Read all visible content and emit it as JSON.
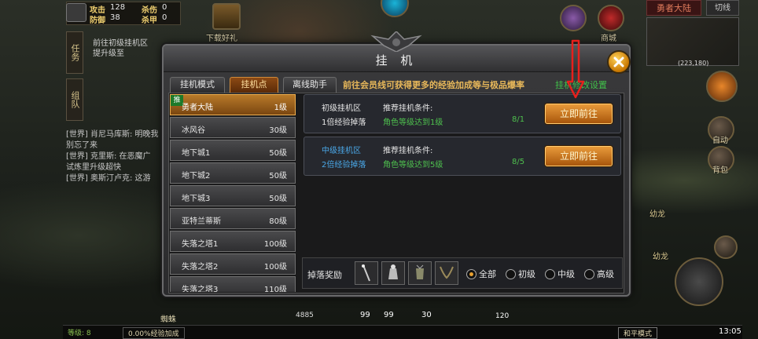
{
  "hud": {
    "attack_label": "攻击",
    "attack_value": "128",
    "pk_label": "杀伤",
    "pk_value": "0",
    "defense_label": "防御",
    "defense_value": "38",
    "armor_label": "杀甲",
    "armor_value": "0",
    "task_tab": "任务",
    "team_tab": "组队",
    "quest_line1": "前往初级挂机区",
    "quest_line2": "提升级至",
    "download_gift": "下载好礼",
    "merchant": "商城",
    "bag": "背包",
    "auto": "自动",
    "minimap_title": "勇者大陆",
    "minimap_switch": "切线",
    "coords": "(223,180)",
    "chat": [
      "[世界] 肖尼马库斯: 明晚我",
      "别忘了来",
      "[世界] 克里斯: 在恶魔广",
      "试炼里升级超快",
      "[世界] 奥斯汀卢克: 这游"
    ],
    "monster_name": "蜘蛛",
    "boss_label": "幼龙",
    "boss_label2": "幼龙",
    "hp_number": "4885",
    "item_counts": [
      "99",
      "99",
      "30",
      "120"
    ],
    "level_label": "等级: 8",
    "exp_bonus": "0.00%经验加成",
    "peace_mode": "和平模式",
    "clock": "13:05"
  },
  "dialog": {
    "title": "挂 机",
    "tabs": [
      "挂机模式",
      "挂机点",
      "离线助手"
    ],
    "active_tab": 1,
    "promo": "前往会员线可获得更多的经验加成等与极品爆率",
    "promo_link": "挂机修改设置",
    "recommend_flag": "推",
    "maps": [
      {
        "name": "勇者大陆",
        "level": "1级"
      },
      {
        "name": "冰风谷",
        "level": "30级"
      },
      {
        "name": "地下城1",
        "level": "50级"
      },
      {
        "name": "地下城2",
        "level": "50级"
      },
      {
        "name": "地下城3",
        "level": "50级"
      },
      {
        "name": "亚特兰蒂斯",
        "level": "80级"
      },
      {
        "name": "失落之塔1",
        "level": "100级"
      },
      {
        "name": "失落之塔2",
        "level": "100级"
      },
      {
        "name": "失落之塔3",
        "level": "110级"
      }
    ],
    "zones": [
      {
        "name": "初级挂机区",
        "drop": "1倍经验掉落",
        "cond_title": "推荐挂机条件:",
        "cond": "角色等级达到1级",
        "progress": "8/1",
        "button": "立即前往",
        "name_color": "#e6e6e6"
      },
      {
        "name": "中级挂机区",
        "drop": "2倍经验掉落",
        "cond_title": "推荐挂机条件:",
        "cond": "角色等级达到5级",
        "progress": "8/5",
        "button": "立即前往",
        "name_color": "#4aa8e8"
      }
    ],
    "drops_label": "掉落奖励",
    "filters": [
      "全部",
      "初级",
      "中级",
      "高级"
    ],
    "selected_filter": 0
  },
  "colors": {
    "accent": "#e8a030",
    "green": "#4ec04e",
    "blue": "#4aa8e8",
    "annotation": "#e8201c"
  }
}
